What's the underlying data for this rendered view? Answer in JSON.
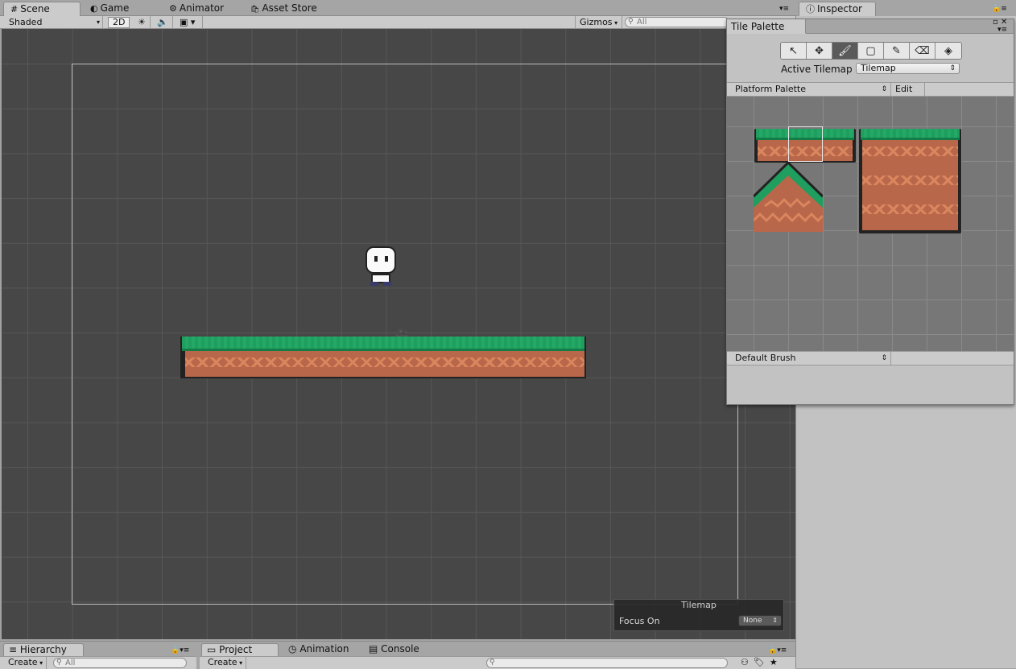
{
  "top_tabs": [
    {
      "icon": "#",
      "label": "Scene"
    },
    {
      "icon": "◐",
      "label": "Game"
    },
    {
      "icon": "⚙",
      "label": "Animator"
    },
    {
      "icon": "🛍",
      "label": "Asset Store"
    }
  ],
  "inspector_tab": "Inspector",
  "scene_toolbar": {
    "shading_mode": "Shaded",
    "mode_2d": "2D",
    "gizmos": "Gizmos",
    "search_placeholder": "All"
  },
  "tile_palette": {
    "title": "Tile Palette",
    "tools": [
      "select",
      "move",
      "paint",
      "box-fill",
      "picker",
      "erase",
      "flood-fill"
    ],
    "selected_tool": "paint",
    "active_tilemap_label": "Active Tilemap",
    "active_tilemap_value": "Tilemap",
    "palette_name": "Platform Palette",
    "edit_label": "Edit",
    "brush": "Default Brush"
  },
  "tilemap_overlay": {
    "title": "Tilemap",
    "focus_label": "Focus On",
    "focus_value": "None"
  },
  "bottom_left_tabs": [
    {
      "label": "Hierarchy"
    }
  ],
  "bottom_right_tabs": [
    {
      "icon": "▭",
      "label": "Project"
    },
    {
      "icon": "◷",
      "label": "Animation"
    },
    {
      "icon": "▤",
      "label": "Console"
    }
  ],
  "hierarchy_create": "Create",
  "hierarchy_search_placeholder": "All",
  "project_create": "Create",
  "colors": {
    "scene_bg": "#474747",
    "grass": "#1f9e5f",
    "dirt": "#b9674a",
    "dirt_wave": "#d9855d",
    "palette_bg": "#777777"
  }
}
